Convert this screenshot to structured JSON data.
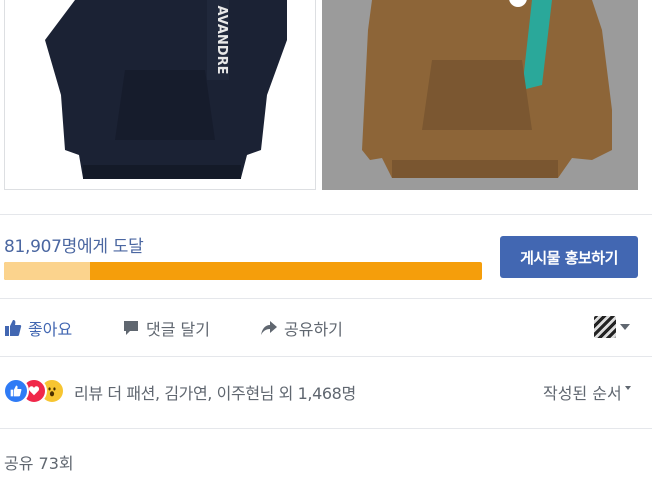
{
  "reach": {
    "text": "81,907명에게 도달",
    "progress_fraction": 0.18
  },
  "boost_button": {
    "label": "게시물 홍보하기"
  },
  "actions": {
    "like_label": "좋아요",
    "comment_label": "댓글 달기",
    "share_label": "공유하기"
  },
  "reactions": {
    "icons": [
      "like-icon",
      "love-icon",
      "wow-icon"
    ],
    "summary": "리뷰 더 패션, 김가연, 이주현님 외 1,468명"
  },
  "sort": {
    "label": "작성된 순서"
  },
  "shares": {
    "label": "공유 73회"
  },
  "colors": {
    "brand_blue": "#4267b2",
    "reach_text": "#4b67a1",
    "progress_fill": "#f59e0b",
    "progress_light": "#fbd38d"
  },
  "photos": [
    {
      "name": "navy-hoodie-photo",
      "garment_color": "#1b2234"
    },
    {
      "name": "brown-hoodie-photo",
      "garment_color": "#8d6538"
    }
  ]
}
